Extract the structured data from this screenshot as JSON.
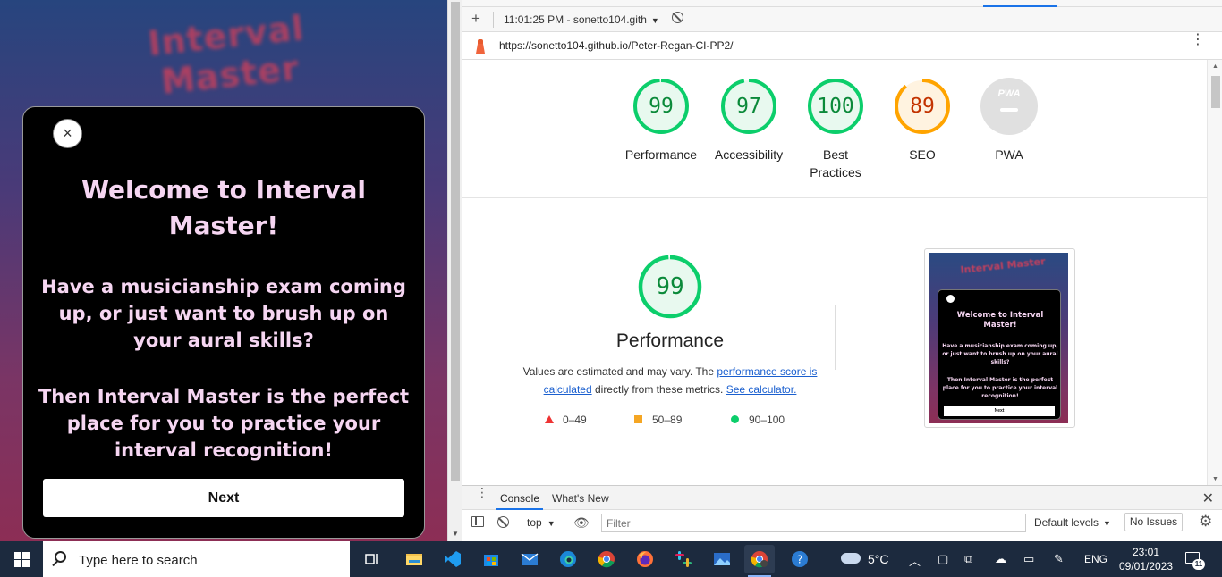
{
  "site": {
    "title": "Interval Master",
    "modal": {
      "close_glyph": "×",
      "heading": "Welcome to Interval Master!",
      "paragraph1": "Have a musicianship exam coming up, or just want to brush up on your aural skills?",
      "paragraph2": "Then Interval Master is the perfect place for you to practice your interval recognition!",
      "next_label": "Next"
    }
  },
  "devtools": {
    "toolbar": {
      "report_selector": "11:01:25 PM - sonetto104.gith",
      "url": "https://sonetto104.github.io/Peter-Regan-CI-PP2/"
    },
    "scores": [
      {
        "label": "Performance",
        "value": 99,
        "color": "#0cce6b",
        "text_color": "#0b8a3a"
      },
      {
        "label": "Accessibility",
        "value": 97,
        "color": "#0cce6b",
        "text_color": "#0b8a3a"
      },
      {
        "label": "Best Practices",
        "value": 100,
        "color": "#0cce6b",
        "text_color": "#0b8a3a"
      },
      {
        "label": "SEO",
        "value": 89,
        "color": "#ffa400",
        "text_color": "#c33300"
      },
      {
        "label": "PWA",
        "value": null,
        "color": "#e0e0e0",
        "text_color": "#ffffff"
      }
    ],
    "pwa_badge_text": "PWA",
    "performance_section": {
      "score": 99,
      "title": "Performance",
      "desc_prefix": "Values are estimated and may vary. The ",
      "desc_link1": "performance score is calculated",
      "desc_middle": " directly from these metrics. ",
      "desc_link2": "See calculator.",
      "legend": [
        {
          "shape": "triangle",
          "range": "0–49",
          "color": "#ff3333"
        },
        {
          "shape": "square",
          "range": "50–89",
          "color": "#ffa400"
        },
        {
          "shape": "circle",
          "range": "90–100",
          "color": "#0cce6b"
        }
      ]
    },
    "thumbnail": {
      "site_title": "Interval Master",
      "heading": "Welcome to Interval Master!",
      "paragraph1": "Have a musicianship exam coming up, or just want to brush up on your aural skills?",
      "paragraph2": "Then Interval Master is the perfect place for you to practice your interval recognition!",
      "next_label": "Next"
    },
    "drawer": {
      "tabs": [
        "Console",
        "What's New"
      ],
      "context": "top",
      "filter_placeholder": "Filter",
      "levels": "Default levels",
      "issues": "No Issues"
    }
  },
  "taskbar": {
    "search_placeholder": "Type here to search",
    "apps": [
      "task-view",
      "file-explorer",
      "vscode",
      "microsoft-store",
      "mail",
      "edge",
      "chrome",
      "firefox",
      "slack",
      "photos",
      "chrome-profile",
      "quick-assist"
    ],
    "weather": "5°C",
    "language": "ENG",
    "time": "23:01",
    "date": "09/01/2023",
    "notification_count": "11"
  }
}
